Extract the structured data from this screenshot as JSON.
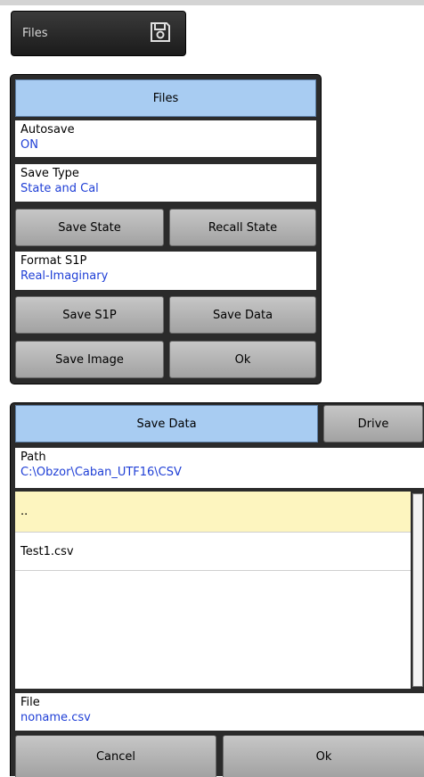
{
  "top_button": {
    "label": "Files",
    "icon": "save-icon"
  },
  "files_menu": {
    "title": "Files",
    "autosave": {
      "label": "Autosave",
      "value": "ON"
    },
    "save_type": {
      "label": "Save Type",
      "value": "State and Cal"
    },
    "save_state": "Save State",
    "recall_state": "Recall State",
    "format_s1p": {
      "label": "Format S1P",
      "value": "Real-Imaginary"
    },
    "save_s1p": "Save S1P",
    "save_data": "Save Data",
    "save_image": "Save Image",
    "ok": "Ok"
  },
  "save_dialog": {
    "title": "Save Data",
    "drive": "Drive",
    "path": {
      "label": "Path",
      "value": "C:\\Obzor\\Caban_UTF16\\CSV"
    },
    "files": [
      "..",
      "Test1.csv"
    ],
    "file": {
      "label": "File",
      "value": "noname.csv"
    },
    "cancel": "Cancel",
    "ok": "Ok"
  },
  "colors": {
    "accent_header": "#a8ccf2",
    "value_text": "#1f3fd6",
    "selected_row": "#fdf5bf",
    "panel_bg": "#2b2b2b"
  }
}
